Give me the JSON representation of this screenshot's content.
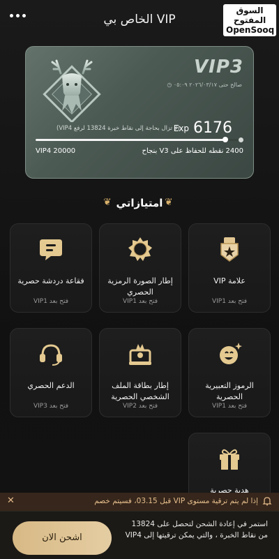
{
  "header": {
    "title": "VIP الخاص بي",
    "watermark_ar": "السوق المفتوح",
    "watermark_en": "OpenSooq"
  },
  "card": {
    "level": "VIP3",
    "validity": "صالح حتى ٢٠٢٦/٠٣/١٧ ٠٥:٠٩",
    "exp_value": "6176",
    "exp_label": "Exp",
    "exp_note": "(لا تزال بحاجة إلى نقاط خبرة 13824 لرفع VIP4)",
    "progress": 0.92,
    "next_level": "VIP4 20000",
    "keep_note": "2400 نقطه للحفاظ على V3 بنجاح"
  },
  "privileges_title": "امتيازاتي",
  "privileges": [
    {
      "name": "علامة VIP",
      "lock": "فتح بعد VIP1",
      "icon": "vip-badge-icon"
    },
    {
      "name": "إطار الصورة الرمزية الحصري",
      "lock": "فتح بعد VIP1",
      "icon": "avatar-frame-icon"
    },
    {
      "name": "فقاعة دردشة حصرية",
      "lock": "فتح بعد VIP1",
      "icon": "chat-bubble-icon"
    },
    {
      "name": "الرموز التعبيرية الحصرية",
      "lock": "فتح بعد VIP1",
      "icon": "emoji-icon"
    },
    {
      "name": "إطار بطاقة الملف الشخصي الحصرية",
      "lock": "فتح بعد VIP2",
      "icon": "profile-card-frame-icon"
    },
    {
      "name": "الدعم الحصري",
      "lock": "فتح بعد VIP3",
      "icon": "headset-icon"
    },
    {
      "name": "هدية حصرية",
      "lock": "",
      "icon": "gift-icon"
    }
  ],
  "notice": {
    "text": "إذا لم يتم ترقية مستوى VIP قبل 03.15، فسيتم خصم",
    "close": "✕"
  },
  "bottom": {
    "cta": "اشحن الان",
    "promo": "استمر في إعادة الشحن لتحصل على 13824 من نقاط الخبرة ، والتي يمكن ترقيتها إلى VIP4"
  },
  "colors": {
    "gold": "#d7b985",
    "card": "#4c5a54",
    "notice_bg": "#36261b"
  }
}
